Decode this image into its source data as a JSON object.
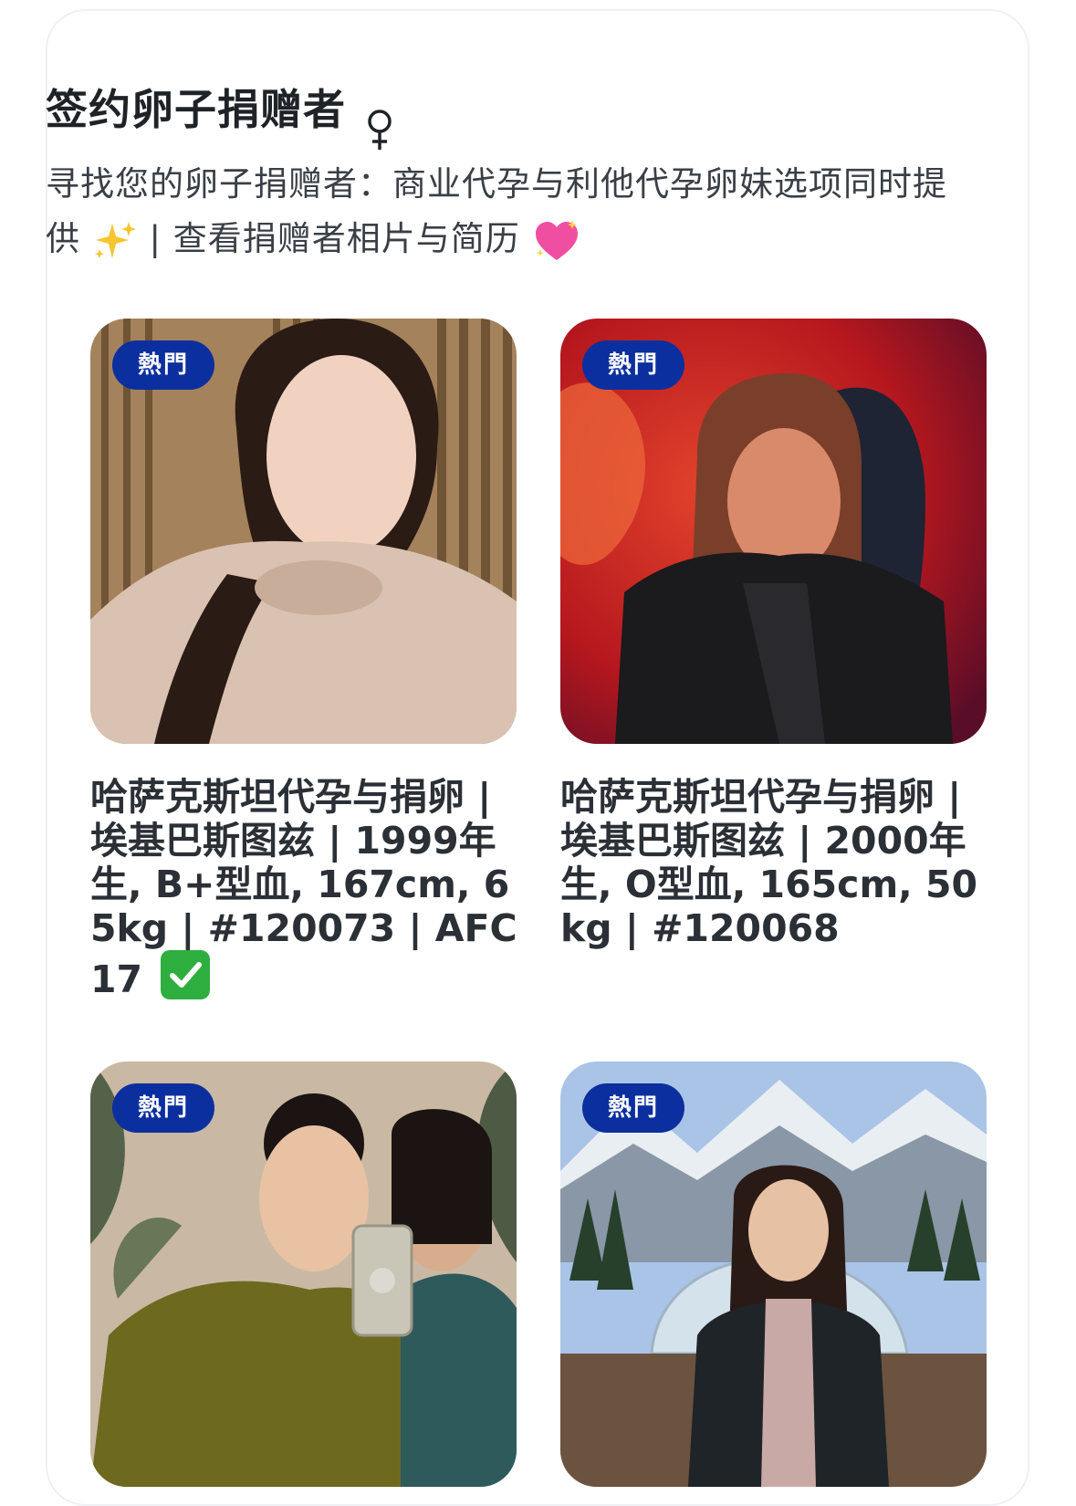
{
  "section": {
    "title": "签约卵子捐赠者",
    "title_icon": "venus-icon",
    "subtitle_part1": "寻找您的卵子捐赠者：商业代孕与利他代孕卵妹选项同时提供",
    "subtitle_part2": "| 查看捐赠者相片与简历",
    "sparkles_icon": "sparkles-icon",
    "heart_icon": "sparkling-heart-icon"
  },
  "donors": [
    {
      "badge": "熱門",
      "caption": "哈萨克斯坦代孕与捐卵 | 埃基巴斯图兹 | 1999年生, B+型血, 167cm, 65kg | #120073 | AFC 17",
      "verified_icon": "check-mark-icon"
    },
    {
      "badge": "熱門",
      "caption": "哈萨克斯坦代孕与捐卵 | 埃基巴斯图兹 | 2000年生, O型血, 165cm, 50kg | #120068"
    },
    {
      "badge": "熱門",
      "caption": ""
    },
    {
      "badge": "熱門",
      "caption": ""
    }
  ],
  "colors": {
    "badge_bg": "#0b2f9e",
    "title": "#1f2328",
    "check": "#2eae3e"
  }
}
